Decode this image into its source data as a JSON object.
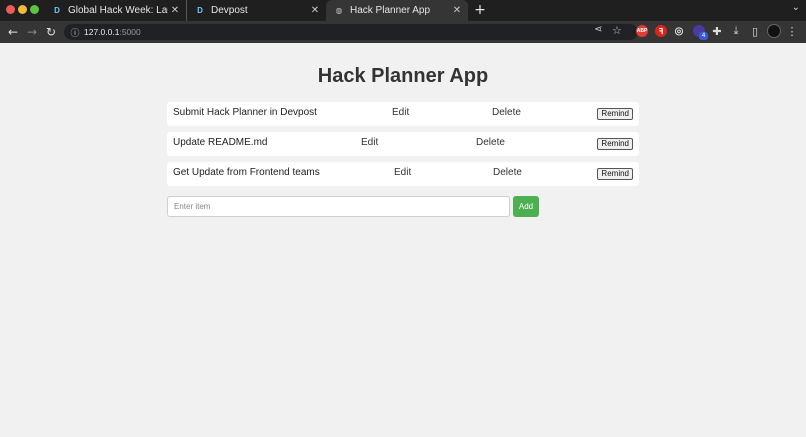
{
  "browser": {
    "tabs": [
      {
        "title": "Global Hack Week: Launch",
        "favicon": "D"
      },
      {
        "title": "Devpost",
        "favicon": "D"
      },
      {
        "title": "Hack Planner App",
        "favicon": "globe-icon",
        "active": true
      }
    ],
    "new_tab_label": "+",
    "url_host": "127.0.0.1",
    "url_port": ":5000",
    "extension_badge": "4",
    "extension_abp_label": "ABP"
  },
  "app": {
    "title": "Hack Planner App",
    "items": [
      {
        "text": "Submit Hack Planner in Devpost",
        "edit": "Edit",
        "delete": "Delete",
        "remind": "Remind"
      },
      {
        "text": "Update README.md",
        "edit": "Edit",
        "delete": "Delete",
        "remind": "Remind"
      },
      {
        "text": "Get Update from Frontend teams",
        "edit": "Edit",
        "delete": "Delete",
        "remind": "Remind"
      }
    ],
    "input_placeholder": "Enter item",
    "add_label": "Add",
    "add_button_color": "#4caf50"
  }
}
